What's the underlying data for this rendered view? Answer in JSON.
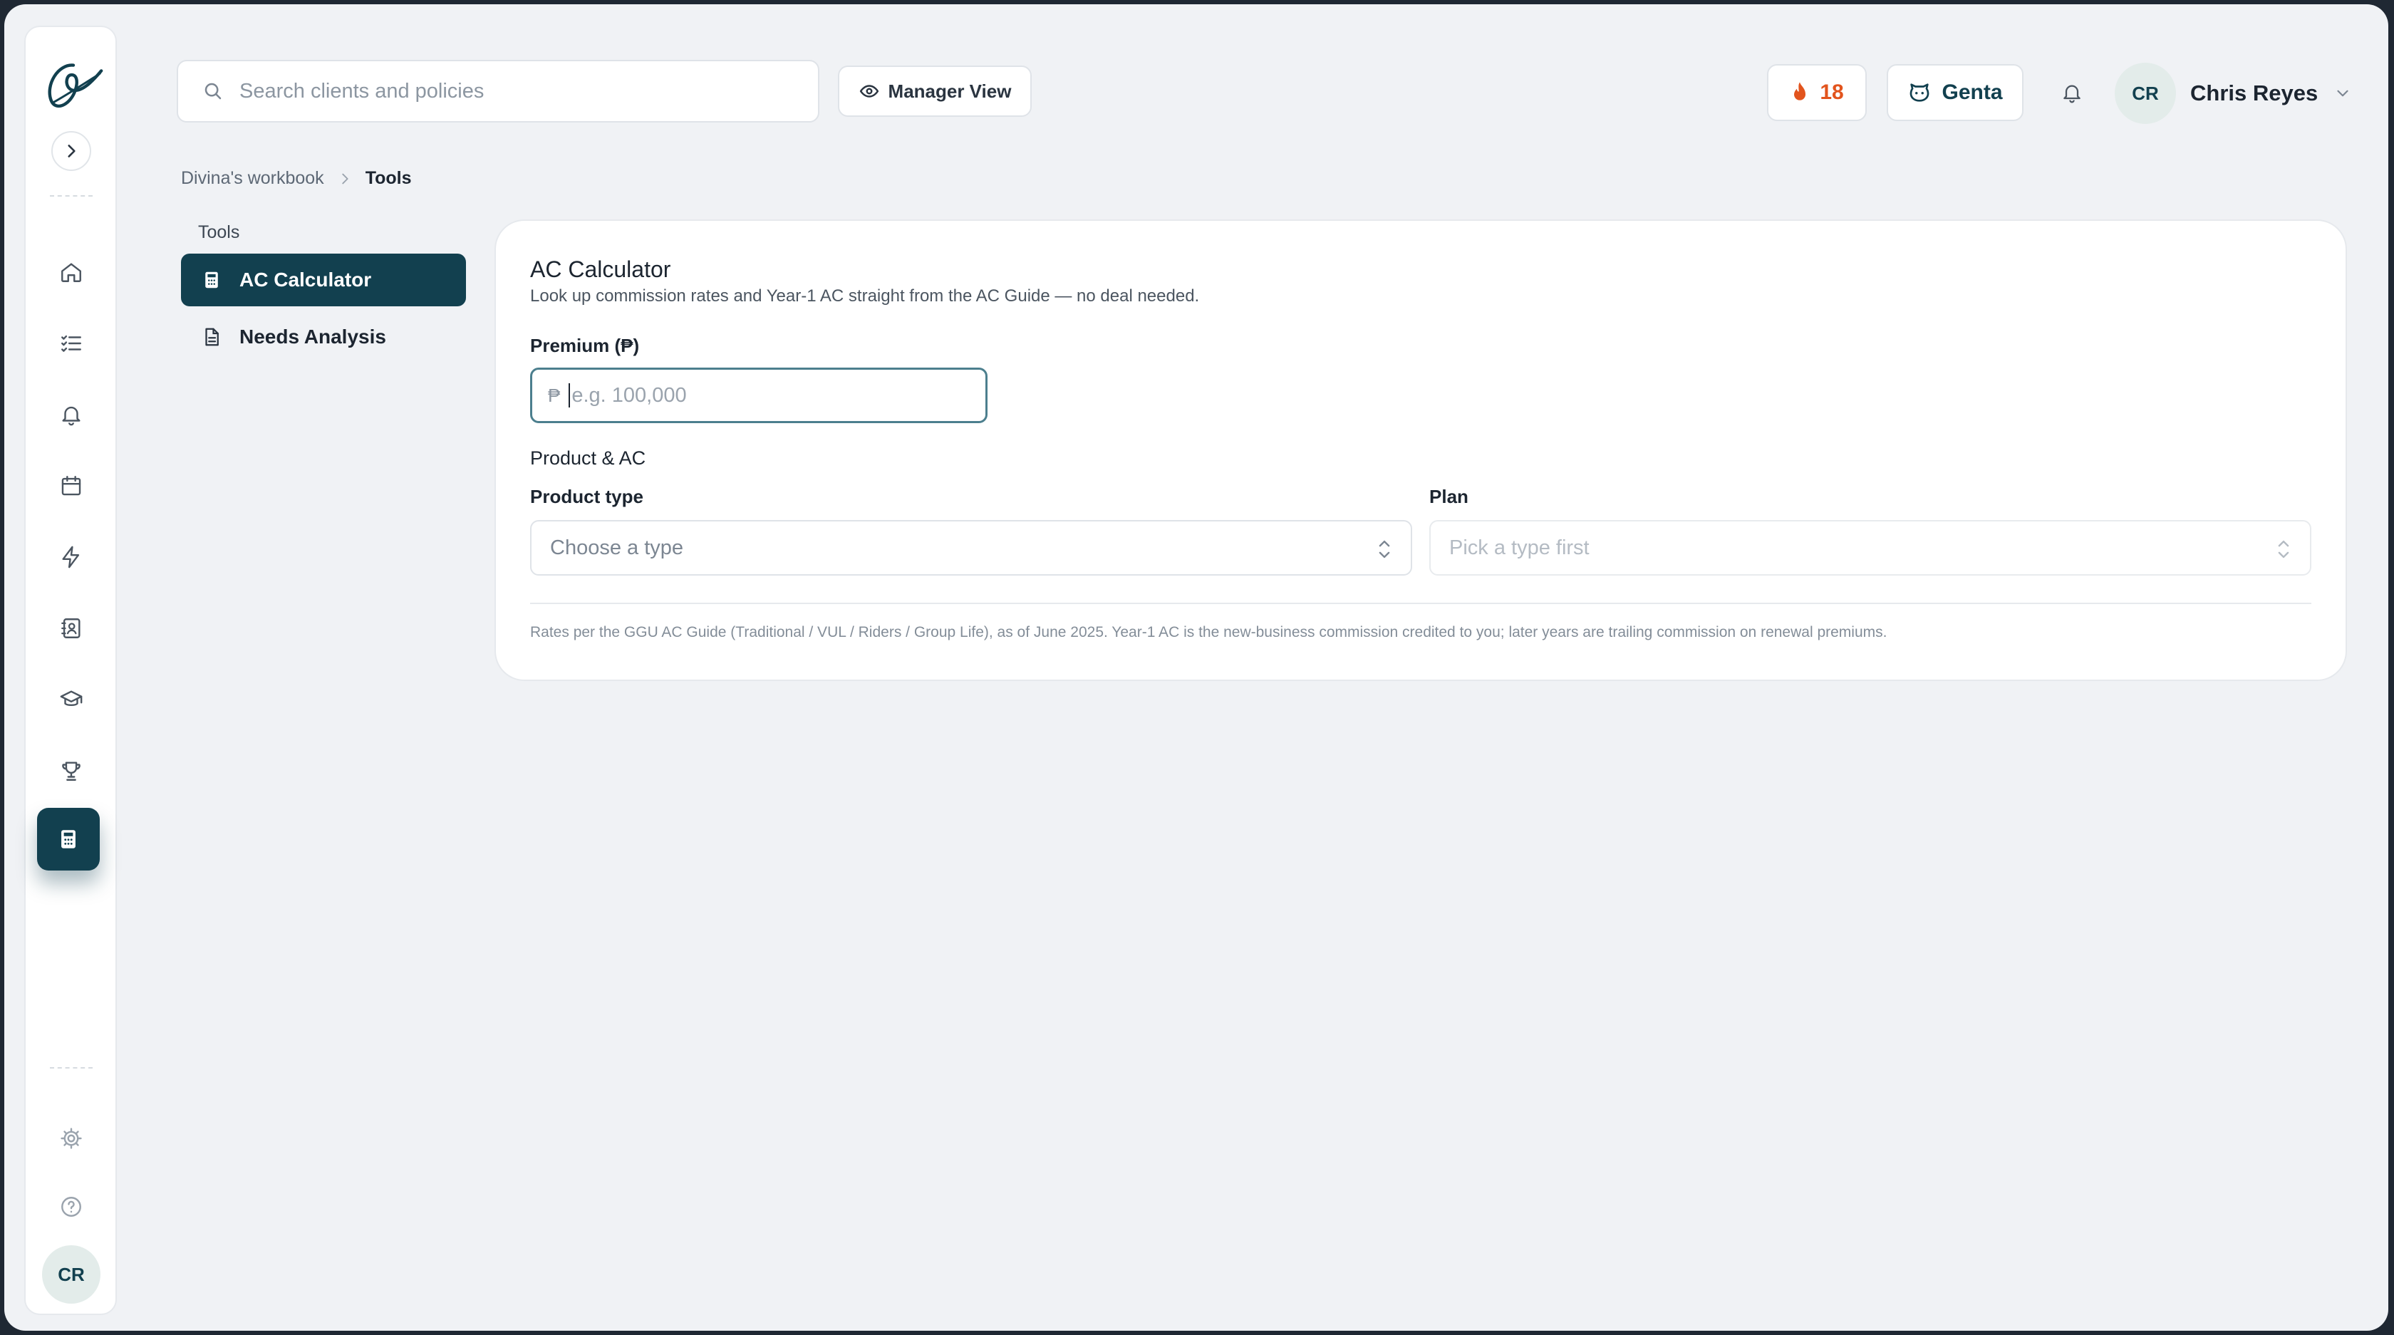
{
  "search": {
    "placeholder": "Search clients and policies"
  },
  "header": {
    "manager_view_label": "Manager View",
    "streak_count": "18",
    "assistant_label": "Genta",
    "user_initials": "CR",
    "user_name": "Chris Reyes"
  },
  "breadcrumb": {
    "parent": "Divina's workbook",
    "current": "Tools"
  },
  "sidebar": {
    "icons": [
      "home-icon",
      "tasks-icon",
      "bell-icon",
      "calendar-icon",
      "lightning-icon",
      "contacts-icon",
      "graduation-cap-icon",
      "trophy-icon",
      "calculator-icon",
      "settings-icon",
      "help-icon"
    ],
    "active": "calculator-icon",
    "avatar_initials": "CR"
  },
  "tools_nav": {
    "heading": "Tools",
    "items": [
      {
        "label": "AC Calculator",
        "icon": "calculator-icon",
        "active": true
      },
      {
        "label": "Needs Analysis",
        "icon": "document-icon",
        "active": false
      }
    ]
  },
  "calculator": {
    "title": "AC Calculator",
    "subtitle": "Look up commission rates and Year-1 AC straight from the AC Guide — no deal needed.",
    "premium_label": "Premium (₱)",
    "currency_symbol": "₱",
    "premium_placeholder": "e.g. 100,000",
    "premium_value": "",
    "section_title": "Product & AC",
    "product_type_label": "Product type",
    "product_type_placeholder": "Choose a type",
    "plan_label": "Plan",
    "plan_placeholder": "Pick a type first",
    "footnote": "Rates per the GGU AC Guide (Traditional / VUL / Riders / Group Life), as of June 2025. Year-1 AC is the new-business commission credited to you; later years are trailing commission on renewal premiums."
  },
  "colors": {
    "accent": "#12404f",
    "streak": "#e2541d",
    "background": "#f0f2f5"
  }
}
